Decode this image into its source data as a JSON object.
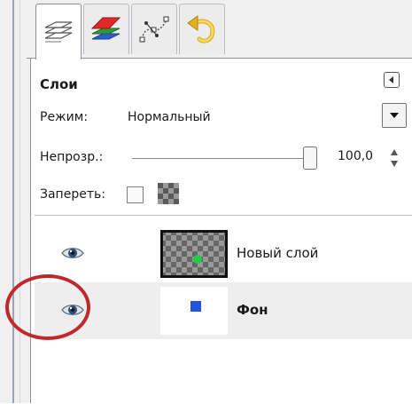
{
  "tabs": [
    {
      "name": "layers-tab",
      "icon": "layers-icon"
    },
    {
      "name": "channels-tab",
      "icon": "channels-icon"
    },
    {
      "name": "paths-tab",
      "icon": "paths-icon"
    },
    {
      "name": "undo-history-tab",
      "icon": "undo-icon"
    }
  ],
  "panel": {
    "title": "Слои",
    "mode_label": "Режим:",
    "mode_value": "Нормальный",
    "opacity_label": "Непрозр.:",
    "opacity_value": "100,0",
    "lock_label": "Запереть:"
  },
  "layers": [
    {
      "name": "Новый слой",
      "visible": true,
      "selected": false
    },
    {
      "name": "Фон",
      "visible": true,
      "selected": true
    }
  ],
  "colors": {
    "accent_red": "#c0282b",
    "layer_dot": "#22cc44",
    "background_square": "#2255dd"
  }
}
